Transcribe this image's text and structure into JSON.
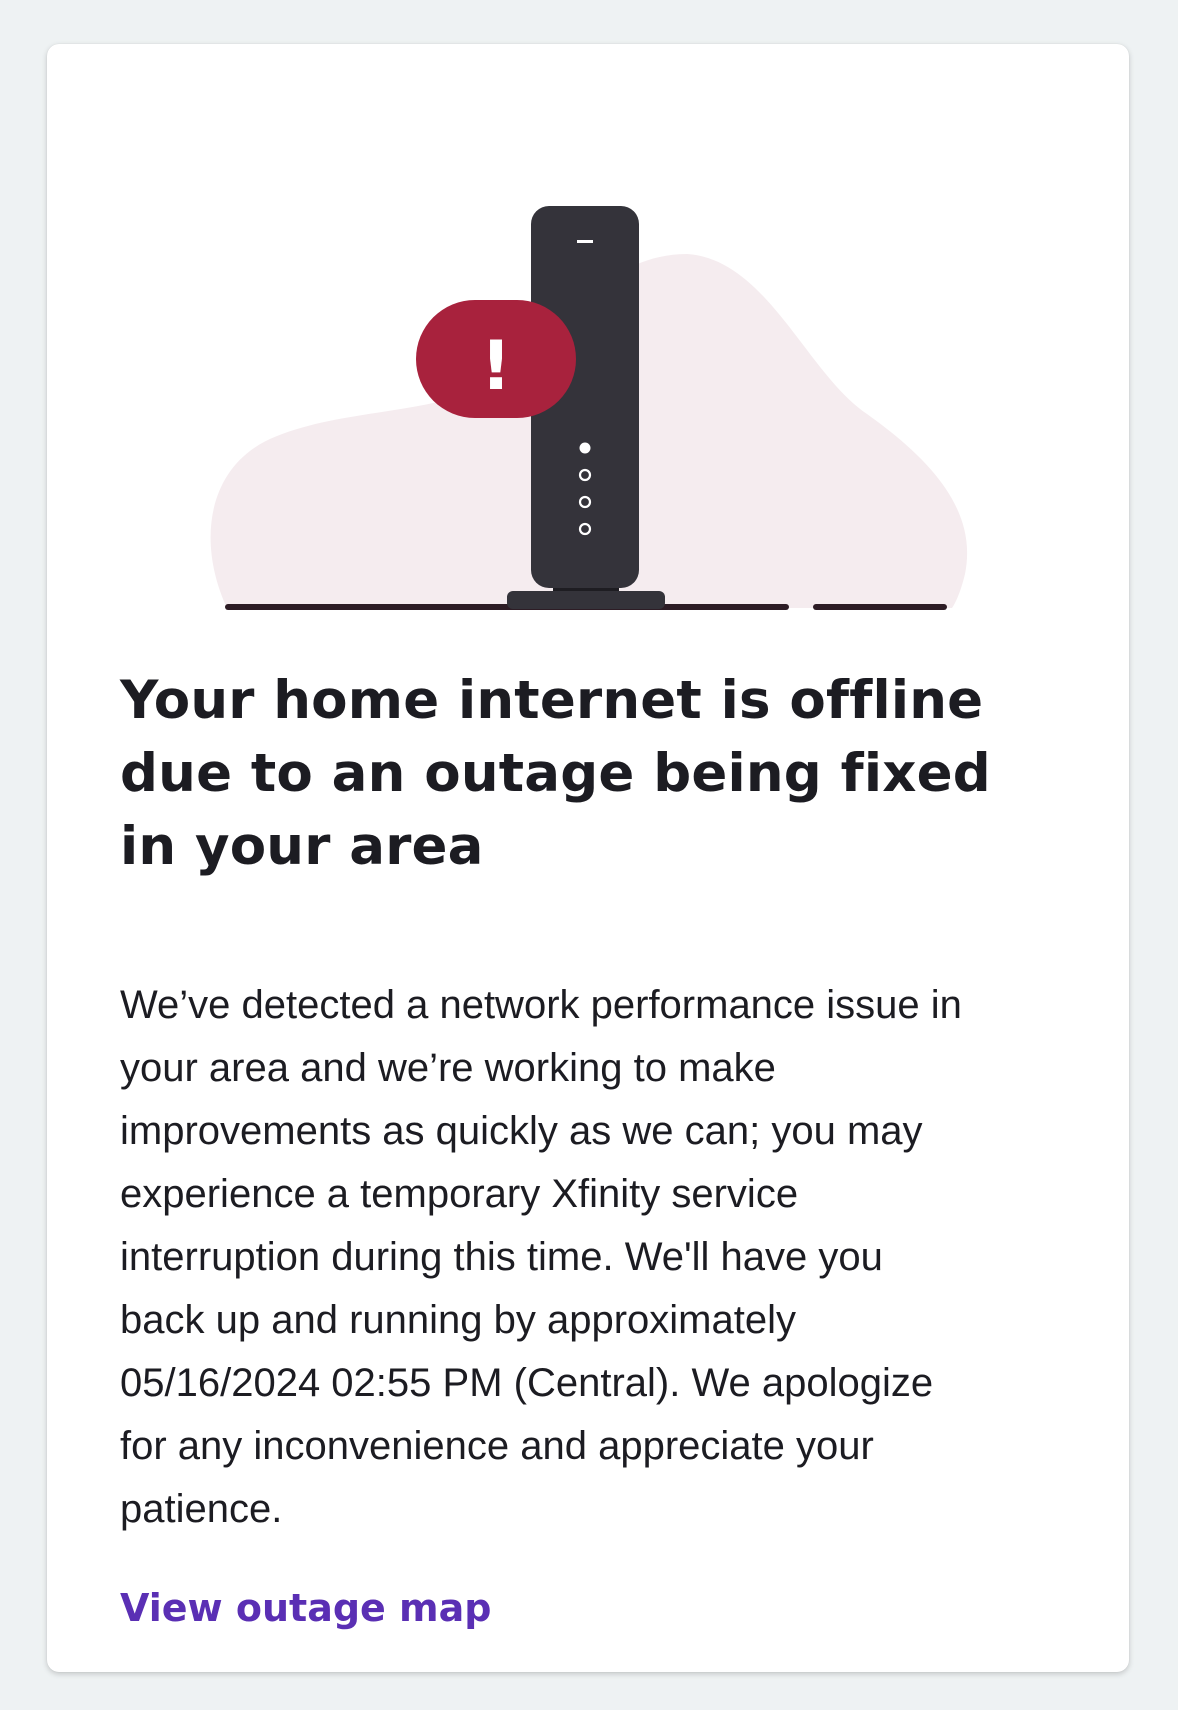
{
  "outage": {
    "headline": "Your home internet is offline due to an outage being fixed in your area",
    "message": "We’ve detected a network performance issue in\nyour area and we’re working to make\nimprovements as quickly as we can; you may\nexperience a temporary Xfinity service\ninterruption during this time.  We'll have you\nback up and running by approximately\n05/16/2024 02:55 PM (Central).  We apologize\nfor any inconvenience and appreciate your\npatience.",
    "link_label": "View outage map",
    "alert_symbol": "!"
  },
  "illustration": {
    "icon": "offline-gateway-icon",
    "alert_icon": "alert-badge-icon",
    "colors": {
      "blob": "#f5ecef",
      "device": "#34333a",
      "alert": "#a8223d",
      "floor": "#2d1c25"
    }
  },
  "colors": {
    "background": "#eef2f3",
    "card": "#ffffff",
    "text": "#1c1c22",
    "link": "#5a2fb4"
  }
}
